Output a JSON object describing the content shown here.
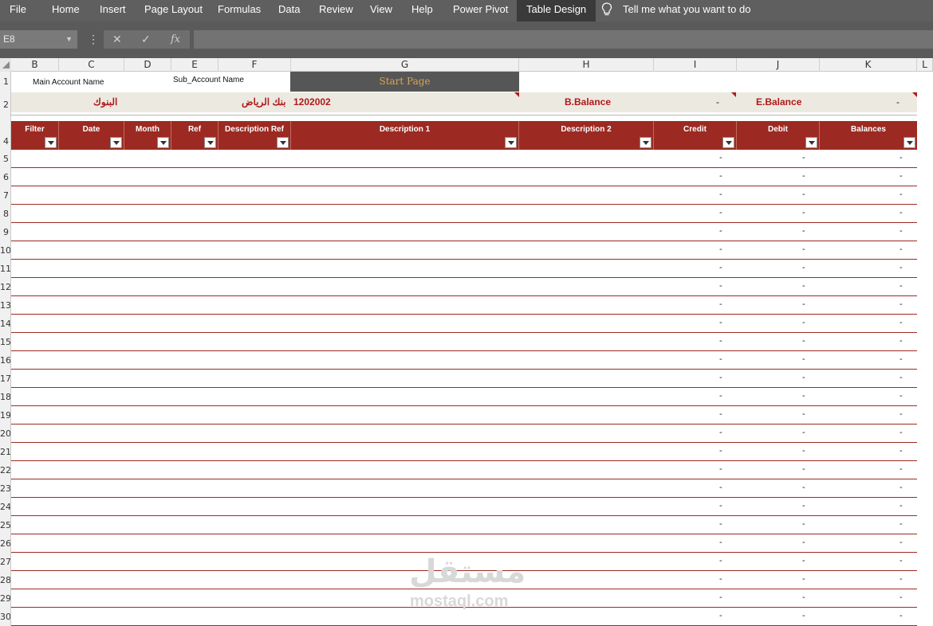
{
  "ribbon": {
    "tabs": [
      {
        "label": "File"
      },
      {
        "label": "Home"
      },
      {
        "label": "Insert"
      },
      {
        "label": "Page Layout"
      },
      {
        "label": "Formulas"
      },
      {
        "label": "Data"
      },
      {
        "label": "Review"
      },
      {
        "label": "View"
      },
      {
        "label": "Help"
      },
      {
        "label": "Power Pivot"
      },
      {
        "label": "Table Design"
      }
    ],
    "active_tab": "Table Design",
    "tell_me": "Tell me what you want to do",
    "tell_me_icon": "lightbulb-icon"
  },
  "formula_bar": {
    "name_box": "E8",
    "cancel_icon": "✕",
    "enter_icon": "✓",
    "fx_label": "fx",
    "formula_value": ""
  },
  "columns": [
    "B",
    "C",
    "D",
    "E",
    "F",
    "G",
    "H",
    "I",
    "J",
    "K",
    "L"
  ],
  "rows": [
    "1",
    "2",
    "3",
    "4",
    "5",
    "6",
    "7",
    "8",
    "9",
    "10",
    "11",
    "12",
    "13",
    "14",
    "15",
    "16",
    "17",
    "18",
    "19",
    "20",
    "21",
    "22",
    "23",
    "24",
    "25",
    "26",
    "27",
    "28",
    "29",
    "30"
  ],
  "sheet": {
    "main_account_label": "Main Account Name",
    "sub_account_label": "Sub_Account Name",
    "start_page": "Start Page",
    "main_account_value": "البنوك",
    "sub_account_value": "بنك الرياض",
    "account_code": "1202002",
    "b_balance_label": "B.Balance",
    "b_balance_value": "-",
    "e_balance_label": "E.Balance",
    "e_balance_value": "-"
  },
  "table": {
    "headers": [
      "Filter",
      "Date",
      "Month",
      "Ref",
      "Description Ref",
      "Description 1",
      "Description 2",
      "Credit",
      "Debit",
      "Balances"
    ],
    "empty_value": "-",
    "row_count": 26,
    "header_color": "#9c2a22"
  },
  "watermark": {
    "arabic": "مستقل",
    "latin": "mostaql.com"
  }
}
